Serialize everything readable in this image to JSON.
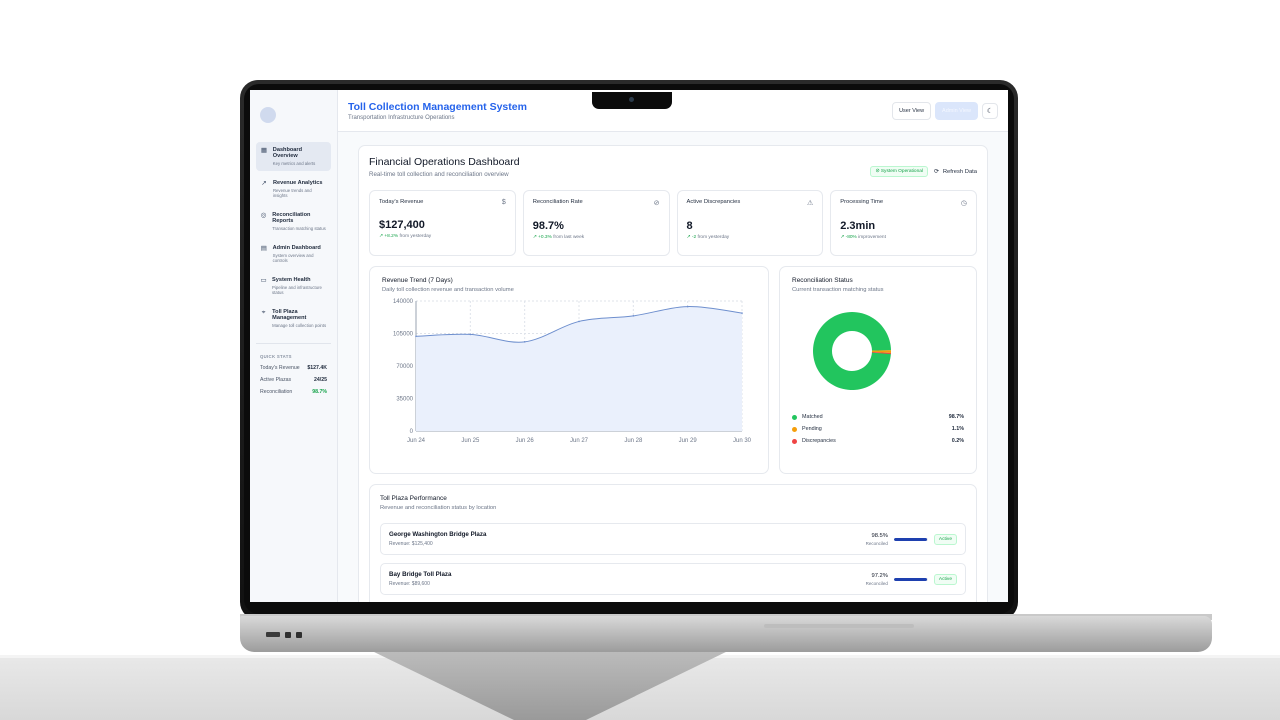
{
  "app": {
    "title": "Toll Collection Management System",
    "subtitle": "Transportation Infrastructure Operations"
  },
  "topbar": {
    "user_view": "User View",
    "admin_view": "Admin View",
    "theme_icon": "moon-icon"
  },
  "sidebar": {
    "items": [
      {
        "label": "Dashboard Overview",
        "desc": "Key metrics and alerts",
        "icon": "dashboard-icon",
        "glyph": "▦"
      },
      {
        "label": "Revenue Analytics",
        "desc": "Revenue trends and insights",
        "icon": "trend-icon",
        "glyph": "↗"
      },
      {
        "label": "Reconciliation Reports",
        "desc": "Transaction matching status",
        "icon": "check-circle-icon",
        "glyph": "◎"
      },
      {
        "label": "Admin Dashboard",
        "desc": "System overview and controls",
        "icon": "document-icon",
        "glyph": "▤"
      },
      {
        "label": "System Health",
        "desc": "Pipeline and infrastructure status",
        "icon": "server-icon",
        "glyph": "▭"
      },
      {
        "label": "Toll Plaza Management",
        "desc": "Manage toll collection points",
        "icon": "location-icon",
        "glyph": "⌖"
      }
    ],
    "quick_stats": {
      "title": "QUICK STATS",
      "rows": [
        {
          "label": "Today's Revenue",
          "value": "$127.4K"
        },
        {
          "label": "Active Plazas",
          "value": "24/25"
        },
        {
          "label": "Reconciliation",
          "value": "98.7%"
        }
      ]
    }
  },
  "dashboard": {
    "title": "Financial Operations Dashboard",
    "subtitle": "Real-time toll collection and reconciliation overview",
    "status_badge": "System Operational",
    "refresh": "Refresh Data"
  },
  "kpis": [
    {
      "label": "Today's Revenue",
      "value": "$127,400",
      "delta": "+8.2%",
      "delta_text": "from yesterday",
      "icon": "dollar-icon",
      "glyph": "$"
    },
    {
      "label": "Reconciliation Rate",
      "value": "98.7%",
      "delta": "+0.3%",
      "delta_text": "from last week",
      "icon": "check-circle-icon",
      "glyph": "⊘"
    },
    {
      "label": "Active Discrepancies",
      "value": "8",
      "delta": "-2",
      "delta_text": "from yesterday",
      "icon": "warning-icon",
      "glyph": "⚠"
    },
    {
      "label": "Processing Time",
      "value": "2.3min",
      "delta": "-80%",
      "delta_text": "improvement",
      "icon": "clock-icon",
      "glyph": "◷"
    }
  ],
  "revenue_card": {
    "title": "Revenue Trend (7 Days)",
    "subtitle": "Daily toll collection revenue and transaction volume"
  },
  "recon_card": {
    "title": "Reconciliation Status",
    "subtitle": "Current transaction matching status"
  },
  "plaza_section": {
    "title": "Toll Plaza Performance",
    "subtitle": "Revenue and reconciliation status by location",
    "rows": [
      {
        "name": "George Washington Bridge Plaza",
        "revenue": "Revenue: $125,400",
        "rate": "98.5%",
        "rate_label": "Reconciled",
        "fill": 0.985,
        "status": "Active"
      },
      {
        "name": "Bay Bridge Toll Plaza",
        "revenue": "Revenue: $89,600",
        "rate": "97.2%",
        "rate_label": "Reconciled",
        "fill": 0.972,
        "status": "Active"
      }
    ]
  },
  "chart_data": [
    {
      "type": "area",
      "categories": [
        "Jun 24",
        "Jun 25",
        "Jun 26",
        "Jun 27",
        "Jun 28",
        "Jun 29",
        "Jun 30"
      ],
      "values": [
        102000,
        104000,
        96000,
        118000,
        124000,
        134000,
        127000
      ],
      "yticks": [
        0,
        35000,
        70000,
        105000,
        140000
      ],
      "ylim": [
        0,
        140000
      ],
      "grid": true,
      "fill_color": "#eaf0fc",
      "line_color": "#6e8fce"
    },
    {
      "type": "pie",
      "donut": true,
      "slices": [
        {
          "label": "Matched",
          "value": 98.7,
          "display": "98.7%",
          "color": "#22c55e"
        },
        {
          "label": "Pending",
          "value": 1.1,
          "display": "1.1%",
          "color": "#f59e0b"
        },
        {
          "label": "Discrepancies",
          "value": 0.2,
          "display": "0.2%",
          "color": "#ef4444"
        }
      ]
    }
  ]
}
